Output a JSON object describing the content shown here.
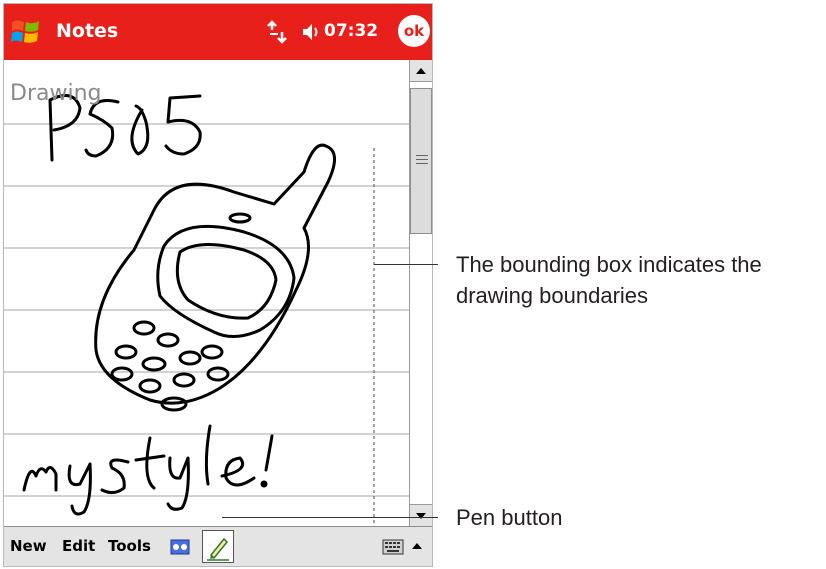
{
  "app": {
    "title": "Notes",
    "clock": "07:32",
    "ok_label": "ok"
  },
  "note": {
    "label": "Drawing",
    "handwriting": [
      "P505",
      "my style!"
    ],
    "bounding_box": "dashed"
  },
  "menu": {
    "new": "New",
    "edit": "Edit",
    "tools": "Tools"
  },
  "icons": {
    "start": "windows-flag-icon",
    "connectivity": "connectivity-icon",
    "volume": "speaker-icon",
    "recorder": "recorder-icon",
    "pen": "pen-icon",
    "input_panel": "keyboard-icon",
    "input_panel_arrow": "arrow-up-icon"
  },
  "callouts": {
    "bounding_box_line1": "The bounding box indicates the",
    "bounding_box_line2": "drawing boundaries",
    "pen_button": "Pen button"
  },
  "colors": {
    "titlebar": "#e8201c",
    "ink": "#000000",
    "ruled_lines": "#b8b8b8"
  }
}
